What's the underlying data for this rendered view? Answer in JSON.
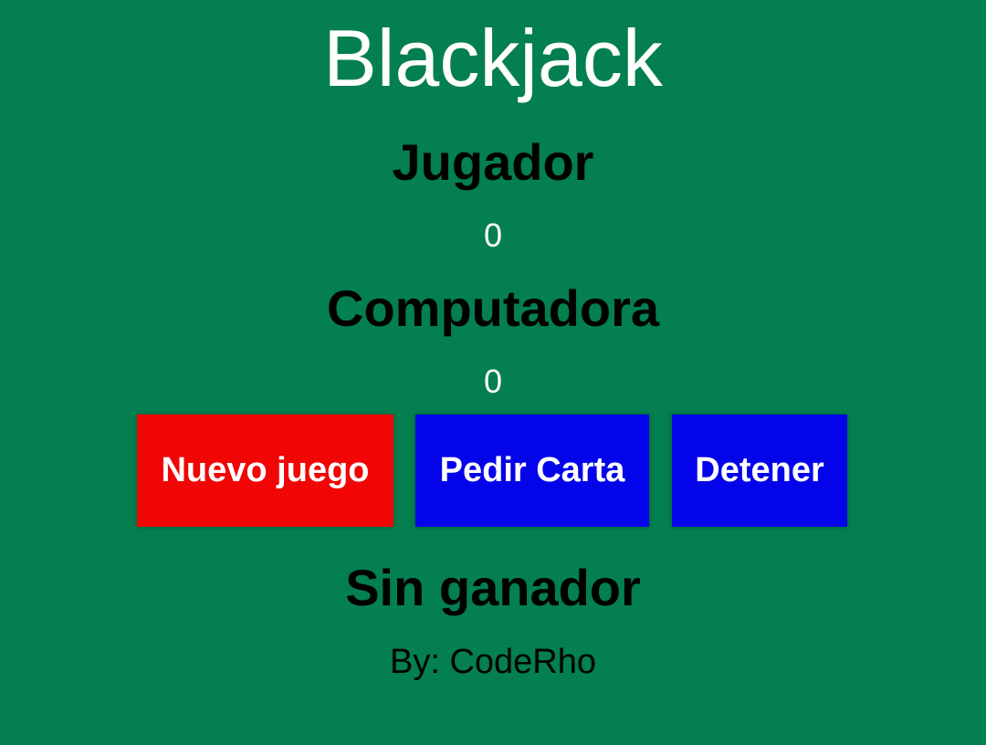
{
  "app": {
    "title": "Blackjack"
  },
  "player": {
    "label": "Jugador",
    "score": "0"
  },
  "computer": {
    "label": "Computadora",
    "score": "0"
  },
  "buttons": {
    "new_game": "Nuevo juego",
    "hit": "Pedir Carta",
    "stand": "Detener"
  },
  "result": "Sin ganador",
  "footer": {
    "byline": "By: CodeRho"
  },
  "colors": {
    "table_background": "#047f4f",
    "new_game_button": "#f10505",
    "action_buttons": "#0404ea",
    "title_text": "#ffffff",
    "heading_text": "#000000"
  }
}
